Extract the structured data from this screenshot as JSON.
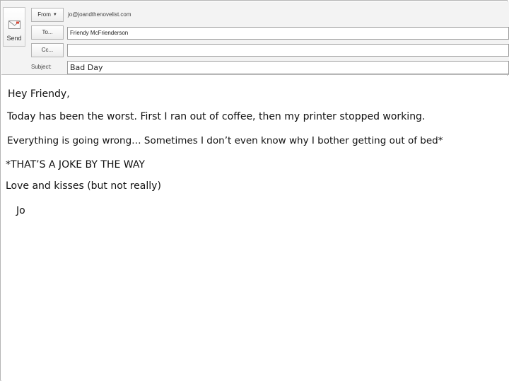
{
  "header": {
    "send_label": "Send",
    "from_label": "From",
    "from_address": "jo@joandthenovelist.com",
    "to_label": "To...",
    "to_value": "Friendy McFrienderson",
    "cc_label": "Cc...",
    "cc_value": "",
    "subject_label": "Subject:",
    "subject_value": "Bad Day"
  },
  "message": {
    "greeting": "Hey Friendy,",
    "line1": "Today has been the worst. First I ran out of coffee, then my printer stopped working.",
    "line2": "Everything is going wrong… Sometimes I don’t even know why I bother getting out of bed*",
    "line3": "*THAT’S A JOKE BY THE WAY",
    "line4": "Love and kisses (but not really)",
    "signature": "Jo"
  },
  "icons": {
    "send": "send-envelope-icon",
    "from_dropdown": "chevron-down-icon"
  }
}
